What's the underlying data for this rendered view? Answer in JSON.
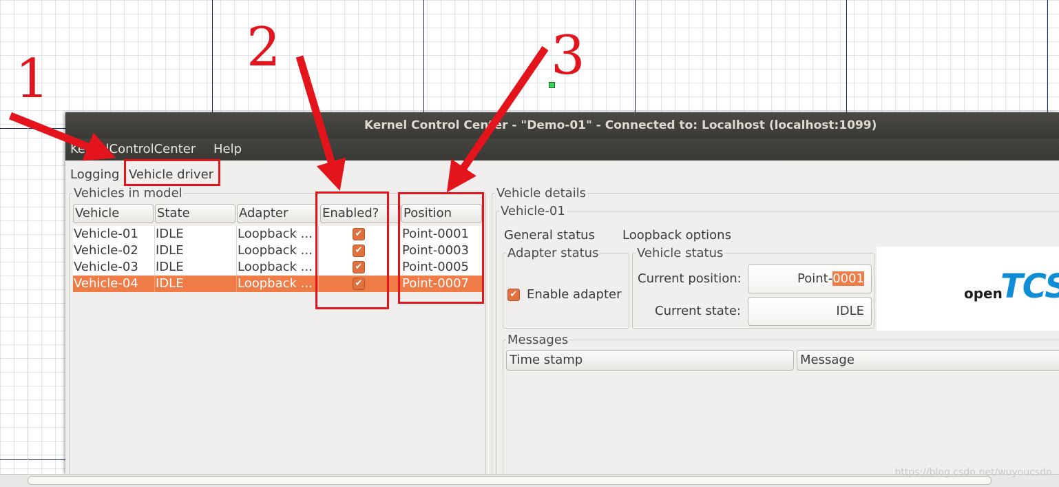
{
  "window": {
    "title": "Kernel Control Center - \"Demo-01\" - Connected to: Localhost (localhost:1099)"
  },
  "menu": {
    "items": [
      "KernelControlCenter",
      "Help"
    ]
  },
  "tabs": {
    "logging": "Logging",
    "vehicle_driver": "Vehicle driver"
  },
  "vehicles_panel": {
    "title": "Vehicles in model",
    "columns": [
      "Vehicle",
      "State",
      "Adapter",
      "Enabled?",
      "Position"
    ],
    "rows": [
      {
        "vehicle": "Vehicle-01",
        "state": "IDLE",
        "adapter": "Loopback ...",
        "enabled": true,
        "position": "Point-0001"
      },
      {
        "vehicle": "Vehicle-02",
        "state": "IDLE",
        "adapter": "Loopback ...",
        "enabled": true,
        "position": "Point-0003"
      },
      {
        "vehicle": "Vehicle-03",
        "state": "IDLE",
        "adapter": "Loopback ...",
        "enabled": true,
        "position": "Point-0005"
      },
      {
        "vehicle": "Vehicle-04",
        "state": "IDLE",
        "adapter": "Loopback ...",
        "enabled": true,
        "position": "Point-0007",
        "selected": true
      }
    ]
  },
  "details": {
    "title": "Vehicle details",
    "vehicle_name": "Vehicle-01",
    "tabs": [
      "General status",
      "Loopback options"
    ],
    "adapter_status": {
      "title": "Adapter status",
      "enable_adapter_label": "Enable adapter",
      "enable_adapter_checked": true
    },
    "vehicle_status": {
      "title": "Vehicle status",
      "current_position_label": "Current position:",
      "current_position_prefix": "Point-",
      "current_position_highlight": "0001",
      "current_state_label": "Current state:",
      "current_state_value": "IDLE"
    },
    "logo": {
      "open": "open",
      "tcs": "TCS"
    },
    "messages": {
      "title": "Messages",
      "columns": [
        "Time stamp",
        "Message"
      ]
    }
  },
  "annotations": {
    "labels": [
      "1",
      "2",
      "3"
    ],
    "color": "#e3141b"
  },
  "watermark": "https://blog.csdn.net/wuyoucsdn",
  "colors": {
    "selection": "#ef7b47",
    "titlebar": "#3a3935",
    "annotation": "#e3141b"
  }
}
